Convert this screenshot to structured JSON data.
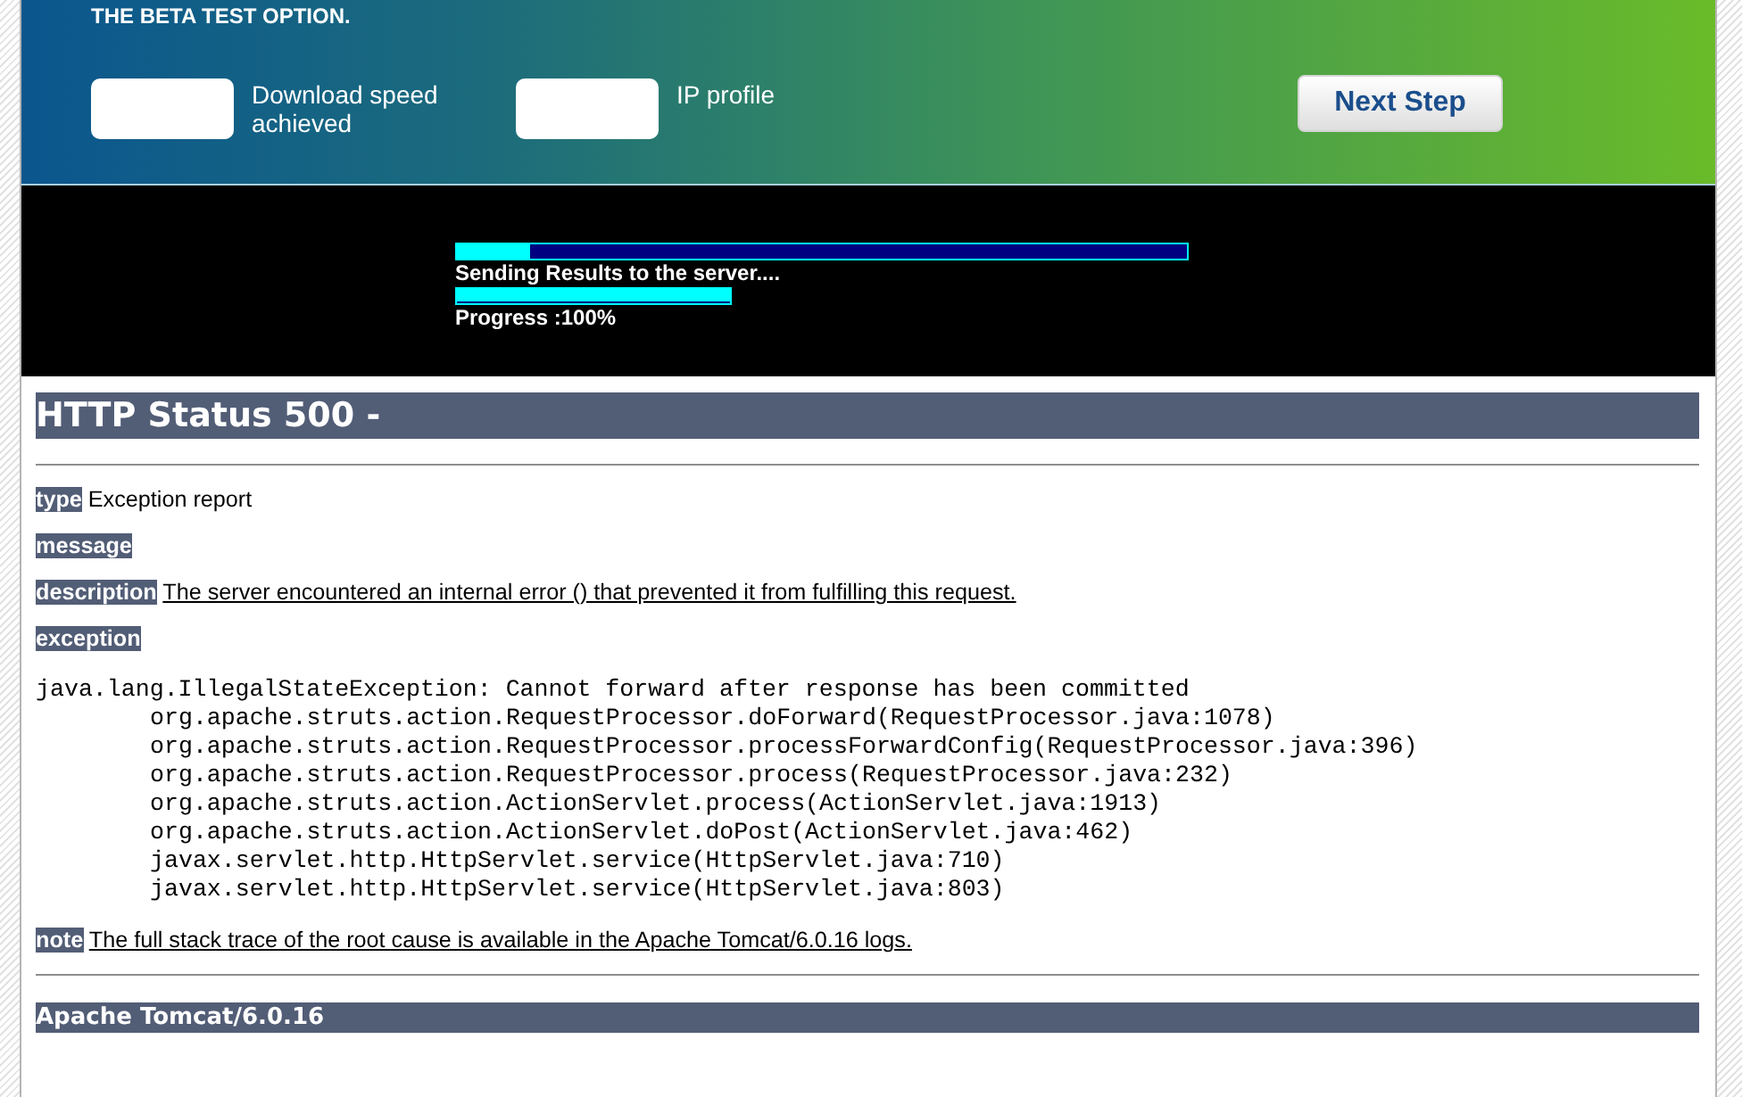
{
  "header": {
    "title": "THE BETA TEST OPTION.",
    "fields": [
      {
        "label": "Download speed achieved"
      },
      {
        "label": "IP profile"
      }
    ],
    "button": "Next Step"
  },
  "progress": {
    "bars": [
      {
        "kind": "wide",
        "level": 0.1,
        "caption": "Sending Results to the server...."
      },
      {
        "kind": "narrow",
        "level": 1,
        "caption": "Progress :100%"
      }
    ]
  },
  "error_page": {
    "heading": "HTTP Status 500 -",
    "sections": [
      {
        "label": "type",
        "text": "Exception report",
        "underlined": false
      },
      {
        "label": "message"
      },
      {
        "label": "description",
        "text": "The server encountered an internal error () that prevented it from fulfilling this request.",
        "underlined": true
      },
      {
        "label": "exception"
      }
    ],
    "exception": {
      "message": "java.lang.IllegalStateException: Cannot forward after response has been committed",
      "frames": [
        "org.apache.struts.action.RequestProcessor.doForward(RequestProcessor.java:1078)",
        "org.apache.struts.action.RequestProcessor.processForwardConfig(RequestProcessor.java:396)",
        "org.apache.struts.action.RequestProcessor.process(RequestProcessor.java:232)",
        "org.apache.struts.action.ActionServlet.process(ActionServlet.java:1913)",
        "org.apache.struts.action.ActionServlet.doPost(ActionServlet.java:462)",
        "javax.servlet.http.HttpServlet.service(HttpServlet.java:710)",
        "javax.servlet.http.HttpServlet.service(HttpServlet.java:803)"
      ]
    },
    "note": {
      "label": "note",
      "text": "The full stack trace of the root cause is available in the Apache Tomcat/6.0.16 logs.",
      "underlined": true
    },
    "footer": "Apache Tomcat/6.0.16"
  }
}
